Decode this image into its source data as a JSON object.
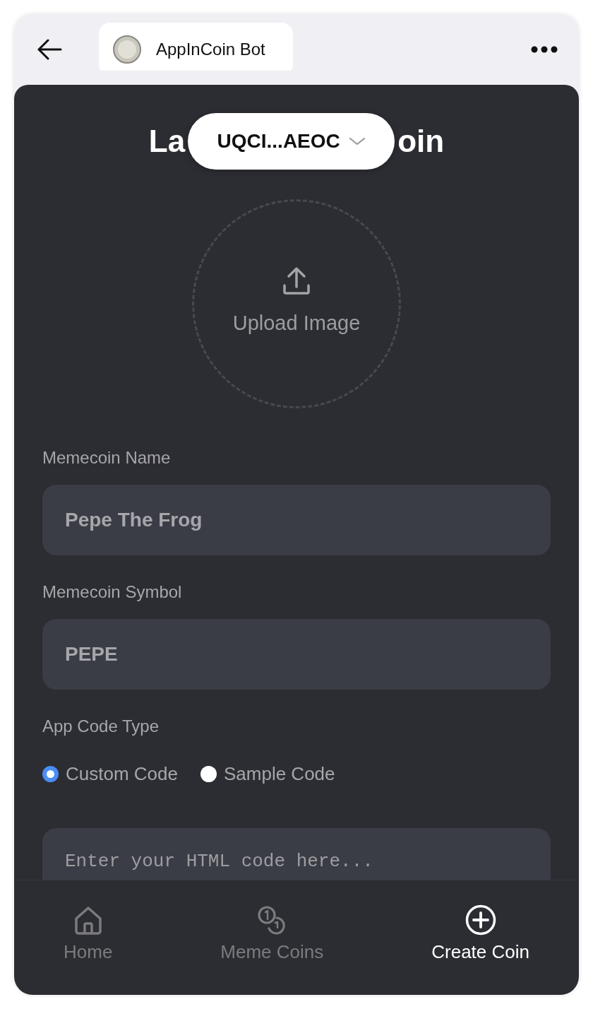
{
  "header": {
    "bot_name": "AppInCoin Bot"
  },
  "heading": {
    "left_part": "La",
    "right_part": "oin"
  },
  "wallet": {
    "address": "UQCI...AEOC"
  },
  "upload": {
    "label": "Upload Image"
  },
  "fields": [
    {
      "label": "Memecoin Name",
      "value": "Pepe The Frog"
    },
    {
      "label": "Memecoin Symbol",
      "value": "PEPE"
    }
  ],
  "code_type": {
    "label": "App Code Type",
    "options": [
      {
        "label": "Custom Code",
        "selected": true
      },
      {
        "label": "Sample Code",
        "selected": false
      }
    ]
  },
  "code_editor": {
    "placeholder": "Enter your HTML code here..."
  },
  "bottom_nav": [
    {
      "kind": "home",
      "label": "Home",
      "selected": false
    },
    {
      "kind": "coins",
      "label": "Meme Coins",
      "selected": false
    },
    {
      "kind": "create",
      "label": "Create Coin",
      "selected": true
    }
  ]
}
